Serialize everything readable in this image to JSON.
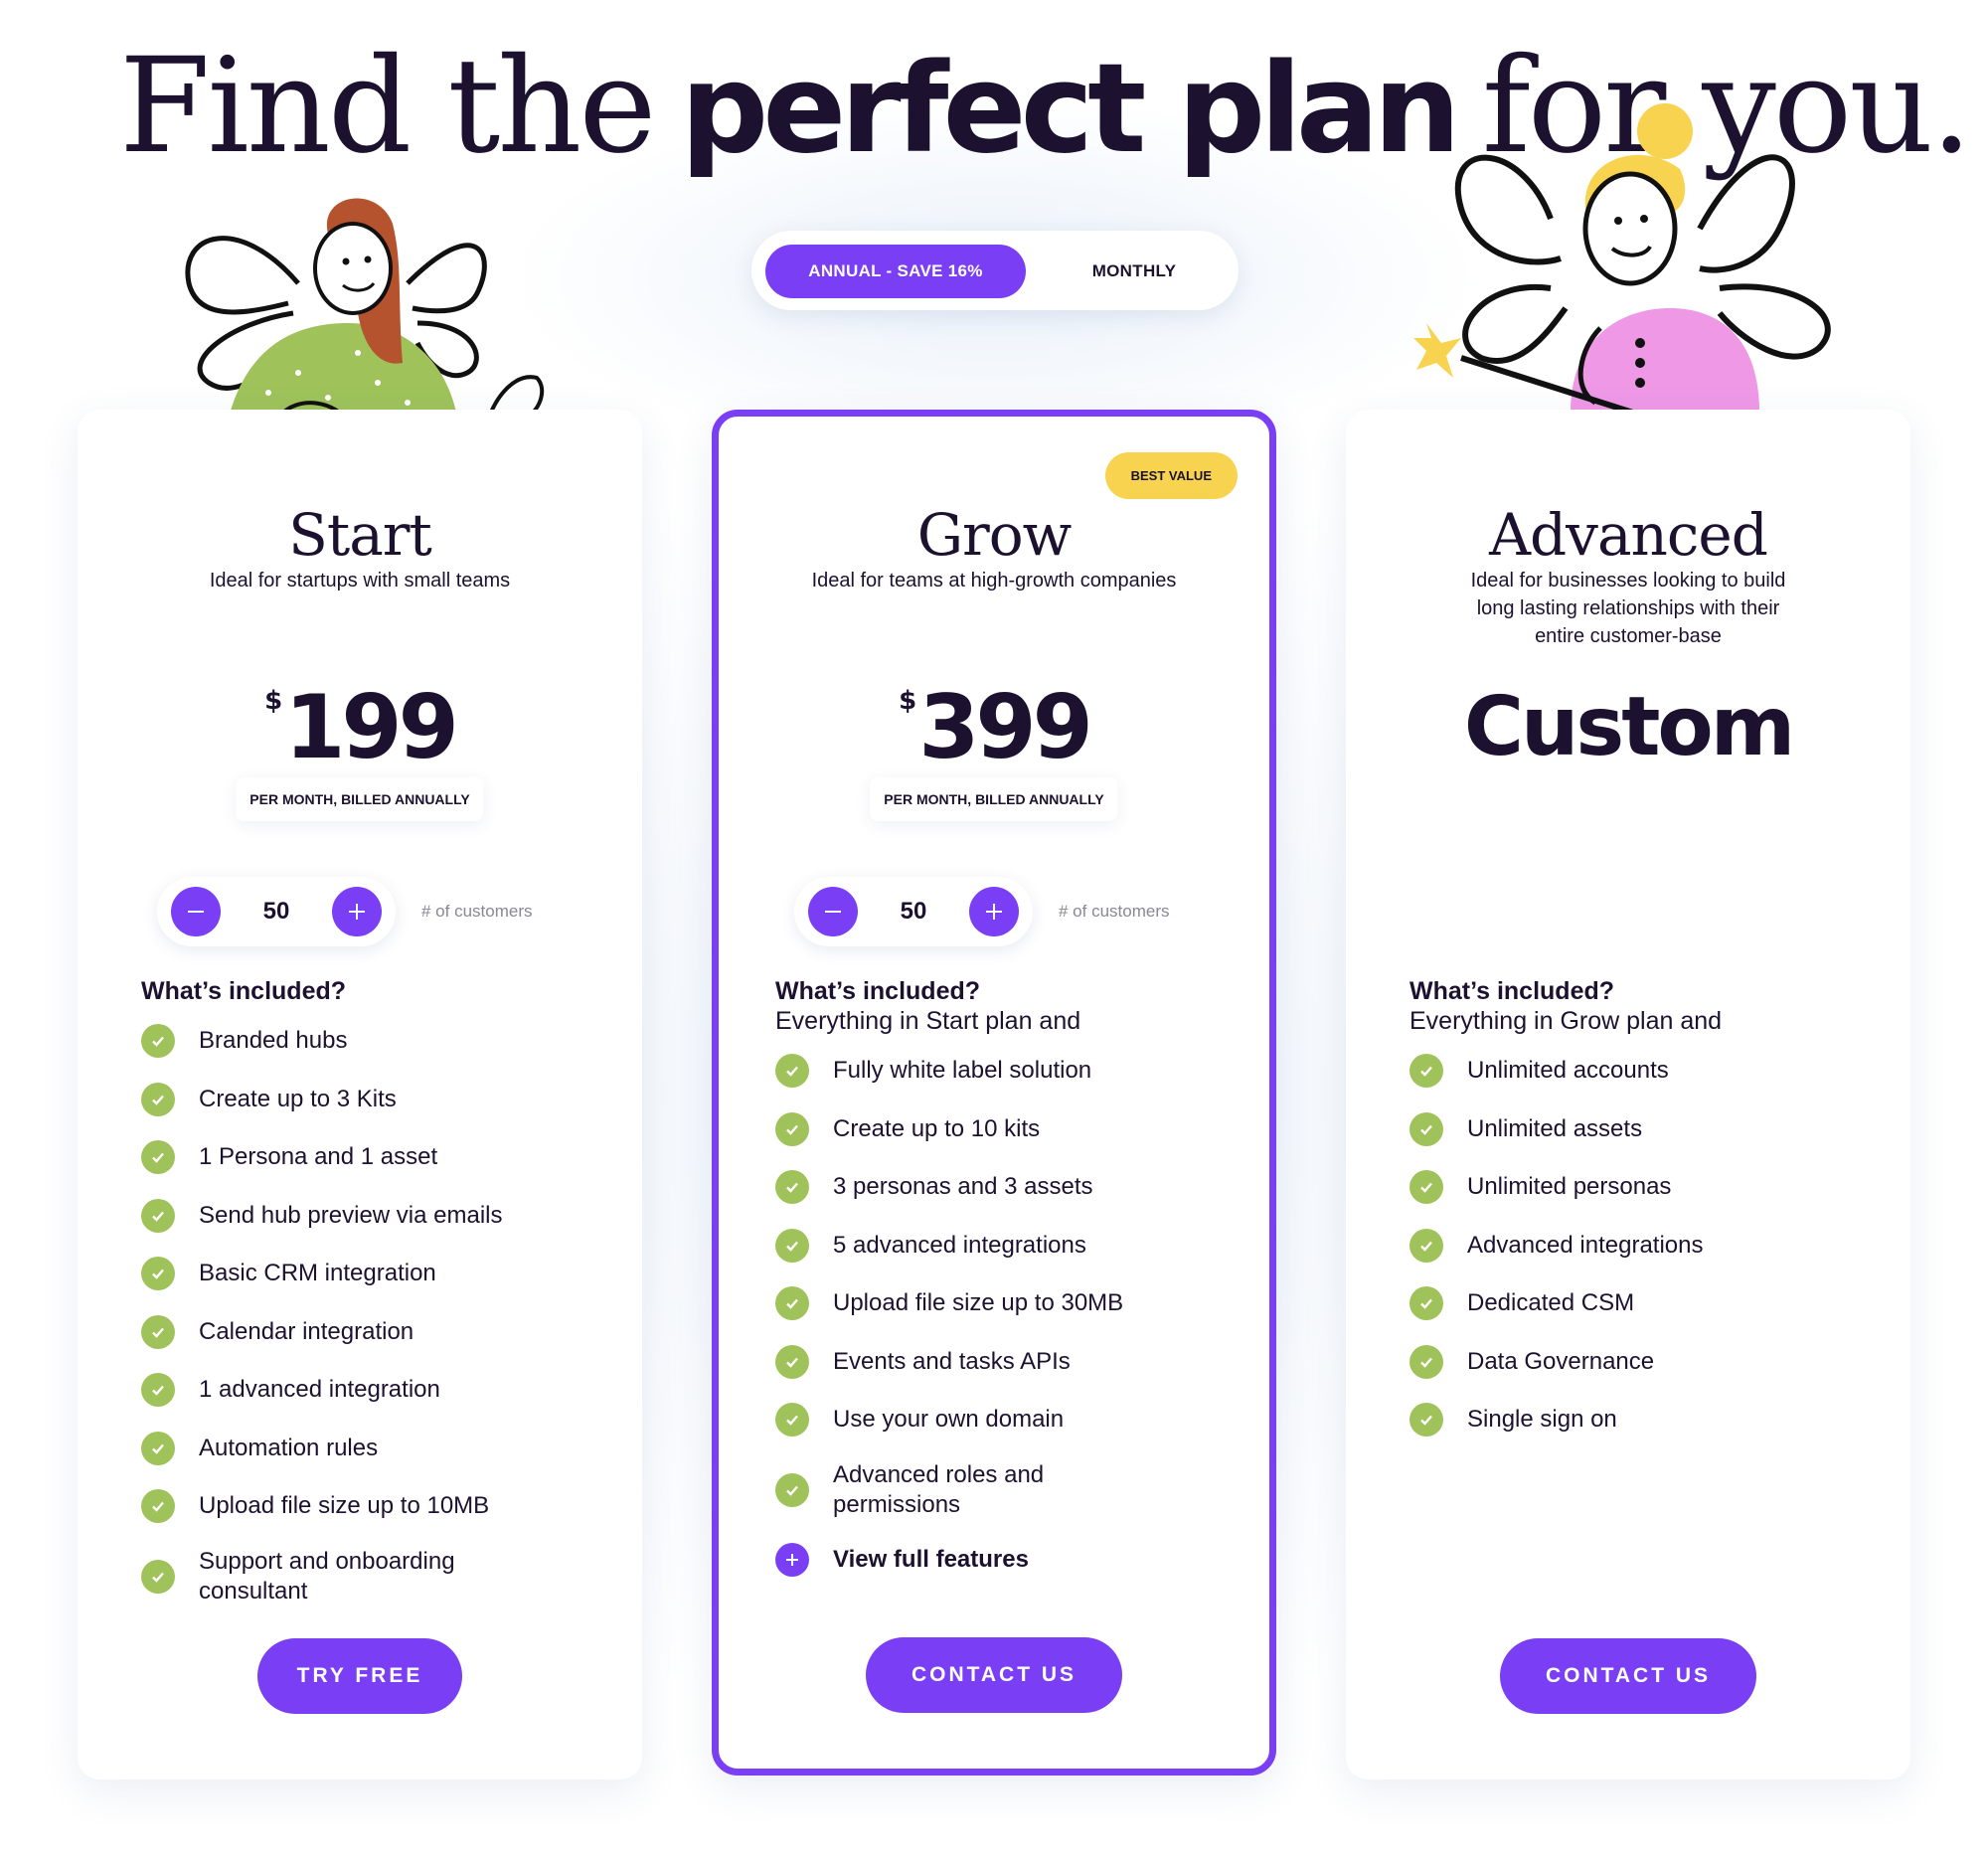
{
  "headline": {
    "part1": "Find the",
    "part2": "perfect plan",
    "part3": "for you."
  },
  "billing_toggle": {
    "annual_label": "ANNUAL - SAVE 16%",
    "monthly_label": "MONTHLY",
    "selected": "annual"
  },
  "colors": {
    "accent": "#7a3ff5",
    "check": "#9fc35a",
    "badge": "#f7d350",
    "text": "#1c1230"
  },
  "plans": [
    {
      "name": "Start",
      "description": "Ideal for startups with small teams",
      "currency": "$",
      "price": "199",
      "billing": "PER MONTH, BILLED ANNUALLY",
      "customers": "50",
      "customers_label": "# of customers",
      "included_title": "What’s included?",
      "features": [
        "Branded hubs",
        "Create up to 3 Kits",
        "1 Persona and 1 asset",
        "Send hub preview via emails",
        "Basic CRM integration",
        "Calendar integration",
        "1 advanced integration",
        "Automation rules",
        "Upload file size up to 10MB",
        "Support and onboarding consultant"
      ],
      "cta": "TRY FREE"
    },
    {
      "name": "Grow",
      "badge": "BEST VALUE",
      "description": "Ideal for teams at high-growth companies",
      "currency": "$",
      "price": "399",
      "billing": "PER MONTH, BILLED ANNUALLY",
      "customers": "50",
      "customers_label": "# of customers",
      "included_title": "What’s included?",
      "included_subtitle": "Everything in Start plan and",
      "features": [
        "Fully white label solution",
        "Create up to 10 kits",
        "3 personas and 3 assets",
        "5 advanced integrations",
        "Upload file size up to 30MB",
        "Events and tasks APIs",
        "Use your own domain",
        "Advanced roles and permissions"
      ],
      "view_full": "View full features",
      "cta": "CONTACT US"
    },
    {
      "name": "Advanced",
      "description": "Ideal for businesses looking to build long lasting relationships with their entire customer-base",
      "price": "Custom",
      "included_title": "What’s included?",
      "included_subtitle": "Everything in Grow plan and",
      "features": [
        "Unlimited accounts",
        "Unlimited assets",
        "Unlimited personas",
        "Advanced integrations",
        "Dedicated CSM",
        "Data Governance",
        "Single sign on"
      ],
      "cta": "CONTACT US"
    }
  ],
  "icons": {
    "check": "check-icon",
    "minus": "minus-icon",
    "plus": "plus-icon"
  }
}
